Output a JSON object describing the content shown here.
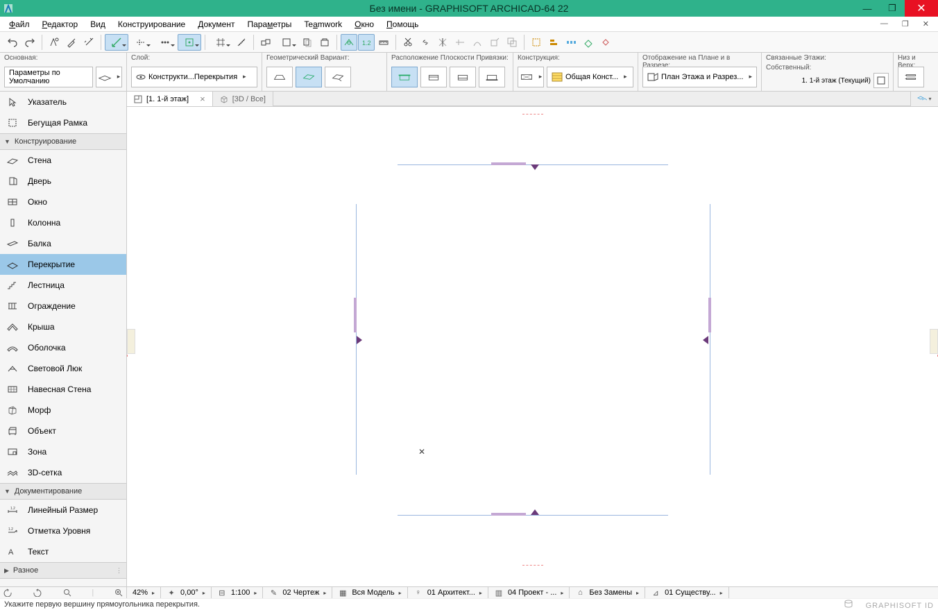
{
  "window": {
    "title": "Без имени - GRAPHISOFT ARCHICAD-64 22"
  },
  "menu": [
    "Файл",
    "Редактор",
    "Вид",
    "Конструирование",
    "Документ",
    "Параметры",
    "Teamwork",
    "Окно",
    "Помощь"
  ],
  "menu_underline": [
    0,
    0,
    null,
    null,
    null,
    4,
    2,
    0,
    0
  ],
  "infobox": {
    "main": {
      "label": "Основная:",
      "value": "Параметры по Умолчанию"
    },
    "layer": {
      "label": "Слой:",
      "value": "Конструкти...Перекрытия"
    },
    "geom": {
      "label": "Геометрический Вариант:"
    },
    "refplane": {
      "label": "Расположение Плоскости Привязки:"
    },
    "construction": {
      "label": "Конструкция:",
      "value": "Общая Конст..."
    },
    "display": {
      "label": "Отображение на Плане и в Разрезе:",
      "value": "План Этажа и Разрез..."
    },
    "stories": {
      "label": "Связанные Этажи:",
      "sub": "Собственный:",
      "value": "1. 1-й этаж (Текущий)"
    },
    "elev": {
      "label": "Низ и Верх:"
    }
  },
  "tabs": [
    {
      "label": "[1. 1-й этаж]",
      "active": true
    },
    {
      "label": "[3D / Все]",
      "active": false
    }
  ],
  "toolbox": {
    "arrow_items": [
      "Указатель",
      "Бегущая Рамка"
    ],
    "sections": [
      {
        "title": "Конструирование",
        "items": [
          "Стена",
          "Дверь",
          "Окно",
          "Колонна",
          "Балка",
          "Перекрытие",
          "Лестница",
          "Ограждение",
          "Крыша",
          "Оболочка",
          "Световой Люк",
          "Навесная Стена",
          "Морф",
          "Объект",
          "Зона",
          "3D-сетка"
        ],
        "selected": 5
      },
      {
        "title": "Документирование",
        "items": [
          "Линейный Размер",
          "Отметка Уровня",
          "Текст"
        ]
      },
      {
        "title": "Разное",
        "items": []
      }
    ]
  },
  "status": {
    "zoom": "42%",
    "angle": "0,00°",
    "scale": "1:100",
    "items": [
      "02 Чертеж",
      "Вся Модель",
      "01 Архитект...",
      "04 Проект - ...",
      "Без Замены",
      "01 Существу..."
    ]
  },
  "hint": "Укажите первую вершину прямоугольника перекрытия.",
  "brand": "GRAPHISOFT ID"
}
